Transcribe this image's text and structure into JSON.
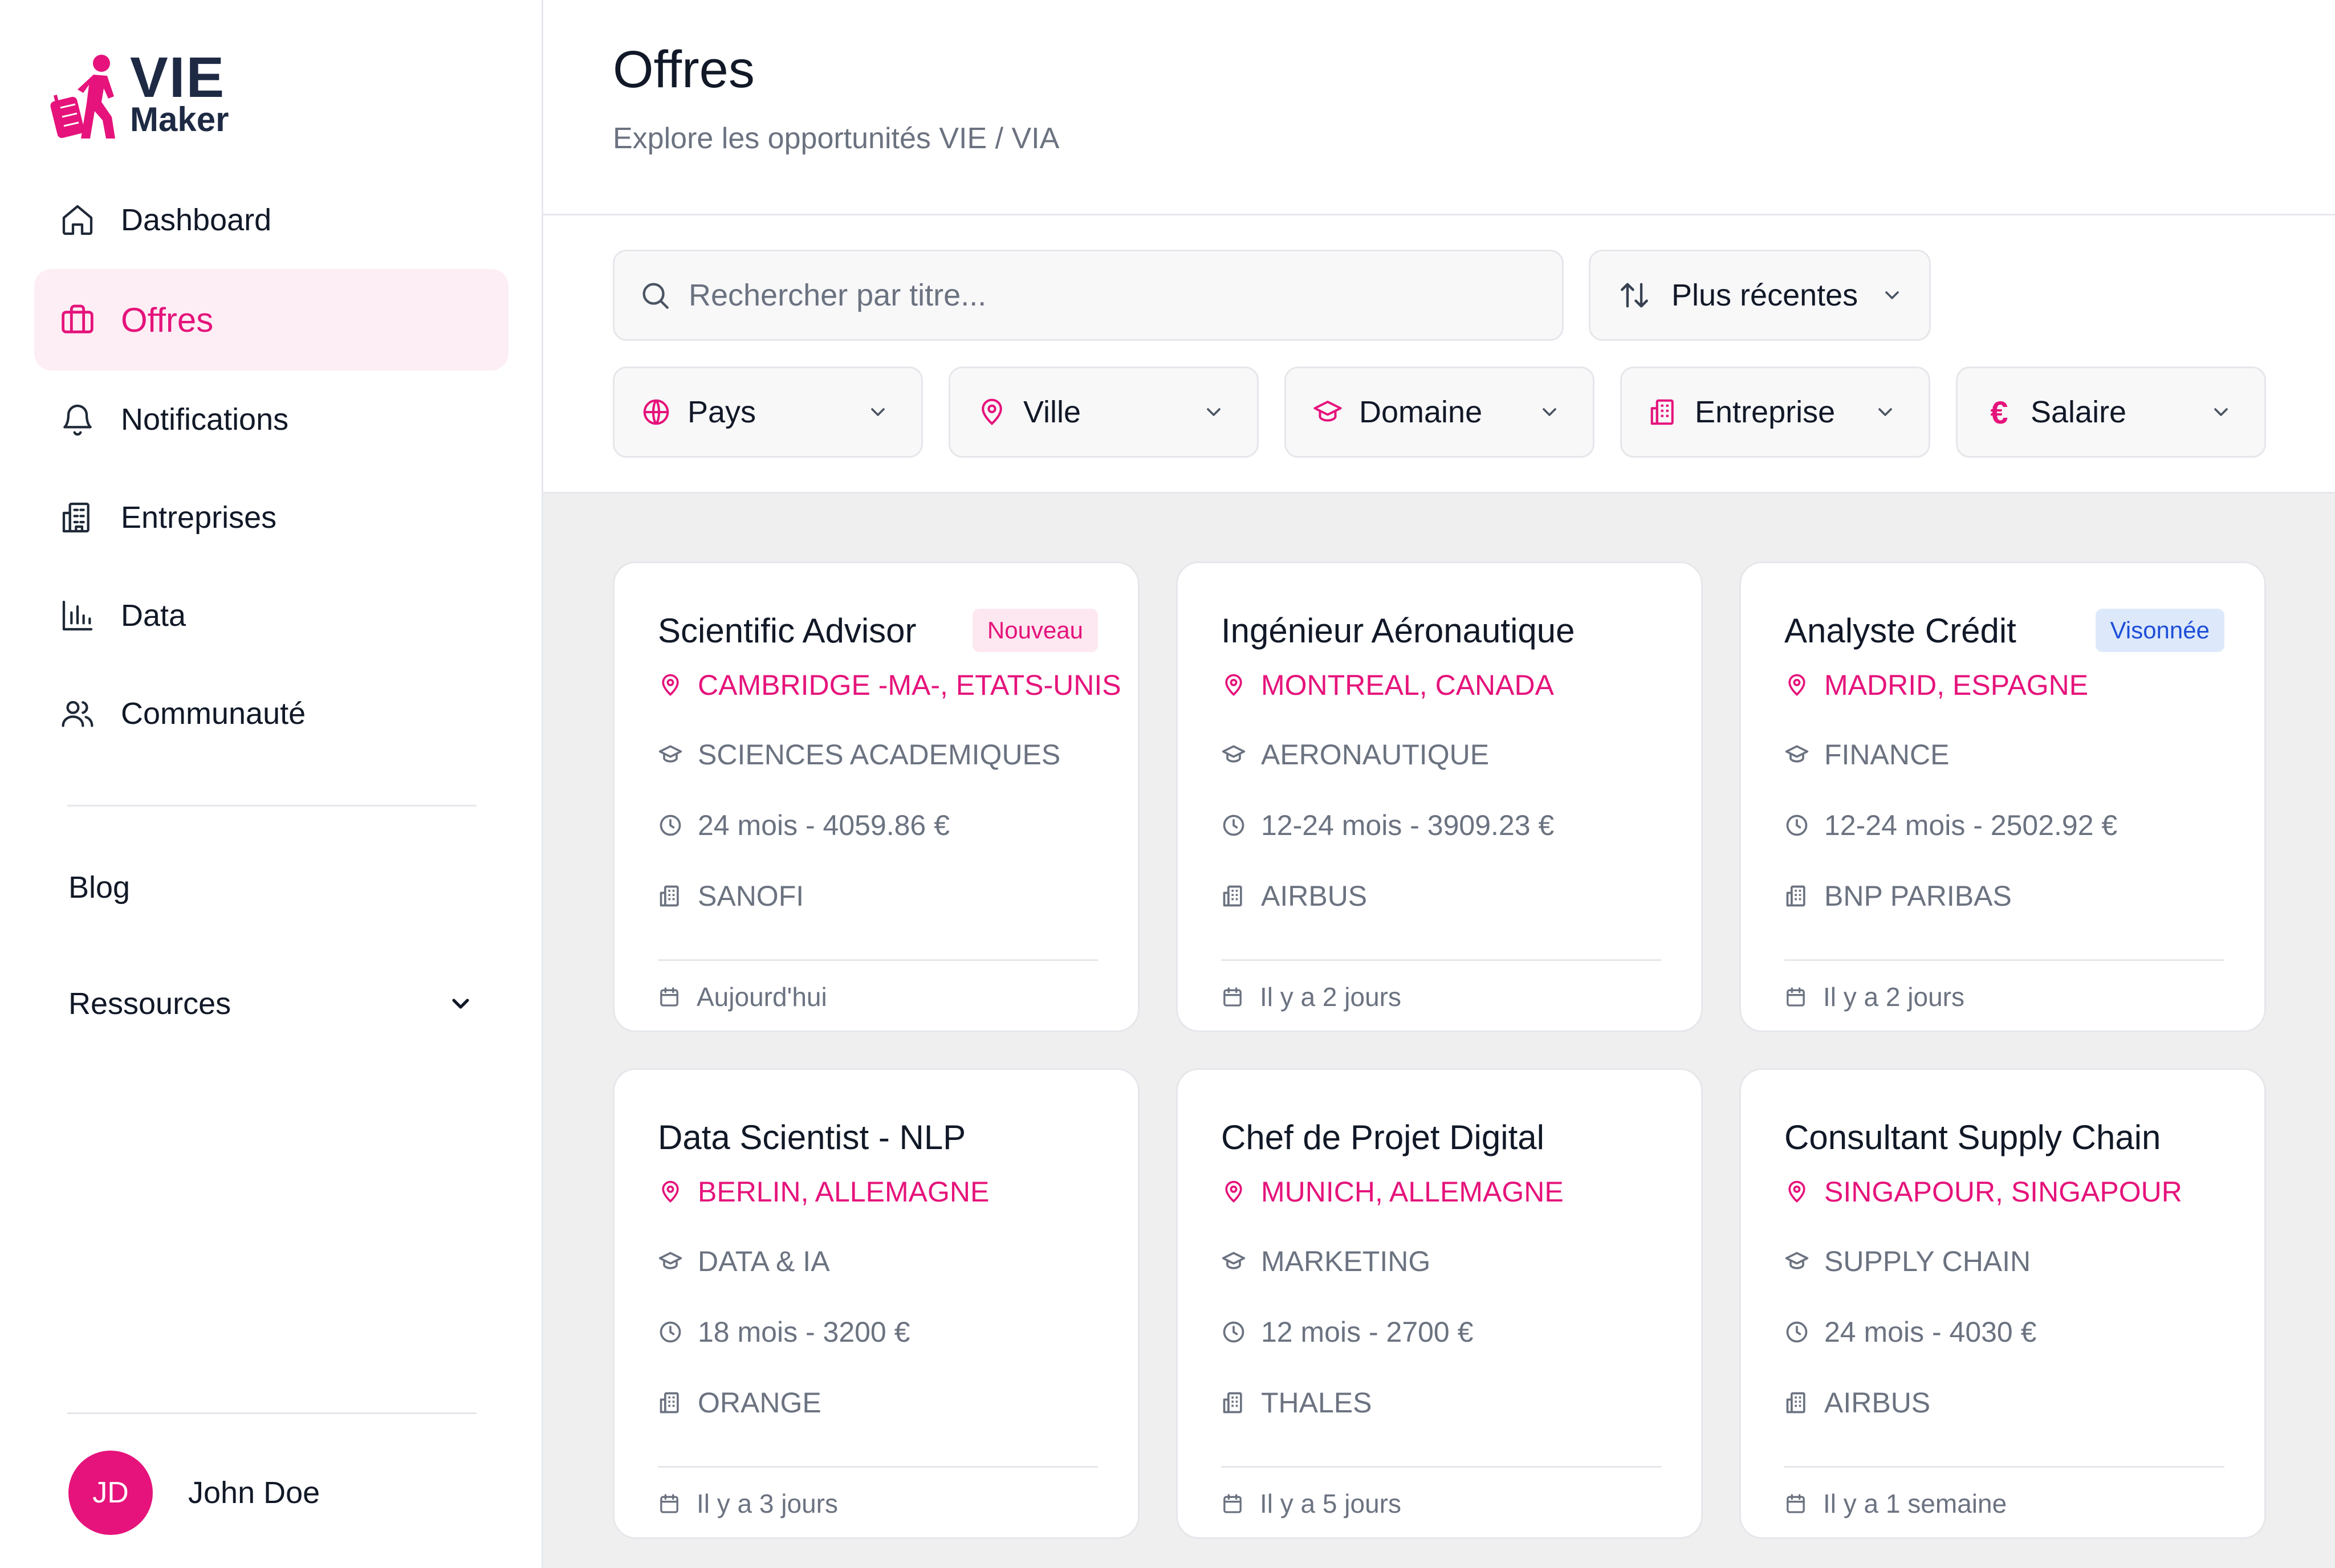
{
  "brand": {
    "line1": "VIE",
    "line2": "Maker",
    "accent": "#e5137b",
    "navy": "#1e2a44"
  },
  "sidebar": {
    "items": [
      {
        "label": "Dashboard",
        "icon": "home-icon",
        "active": false
      },
      {
        "label": "Offres",
        "icon": "briefcase-icon",
        "active": true
      },
      {
        "label": "Notifications",
        "icon": "bell-icon",
        "active": false
      },
      {
        "label": "Entreprises",
        "icon": "building-icon",
        "active": false
      },
      {
        "label": "Data",
        "icon": "bar-chart-icon",
        "active": false
      },
      {
        "label": "Communauté",
        "icon": "users-icon",
        "active": false
      }
    ],
    "blog": "Blog",
    "resources": "Ressources",
    "user": {
      "initials": "JD",
      "name": "John Doe"
    }
  },
  "header": {
    "title": "Offres",
    "subtitle": "Explore les opportunités VIE / VIA"
  },
  "filters": {
    "search_placeholder": "Rechercher par titre...",
    "sort_label": "Plus récentes",
    "chips": [
      {
        "label": "Pays",
        "icon": "globe-icon"
      },
      {
        "label": "Ville",
        "icon": "map-pin-icon"
      },
      {
        "label": "Domaine",
        "icon": "graduation-cap-icon"
      },
      {
        "label": "Entreprise",
        "icon": "building-icon"
      },
      {
        "label": "Salaire",
        "icon": "euro-icon"
      }
    ]
  },
  "offers": [
    {
      "title": "Scientific Advisor",
      "badge": "Nouveau",
      "badge_type": "new",
      "location": "CAMBRIDGE -MA-, ETATS-UNIS",
      "domain": "SCIENCES ACADEMIQUES",
      "duration": "24 mois - 4059.86 €",
      "company": "SANOFI",
      "posted": "Aujourd'hui"
    },
    {
      "title": "Ingénieur Aéronautique",
      "badge": "",
      "badge_type": "",
      "location": "MONTREAL, CANADA",
      "domain": "AERONAUTIQUE",
      "duration": "12-24 mois - 3909.23 €",
      "company": "AIRBUS",
      "posted": "Il y a 2 jours"
    },
    {
      "title": "Analyste Crédit",
      "badge": "Visonnée",
      "badge_type": "seen",
      "location": "MADRID, ESPAGNE",
      "domain": "FINANCE",
      "duration": "12-24 mois - 2502.92 €",
      "company": "BNP PARIBAS",
      "posted": "Il y a 2 jours"
    },
    {
      "title": "Data Scientist - NLP",
      "badge": "",
      "badge_type": "",
      "location": "BERLIN, ALLEMAGNE",
      "domain": "DATA & IA",
      "duration": "18 mois - 3200 €",
      "company": "ORANGE",
      "posted": "Il y a 3 jours"
    },
    {
      "title": "Chef de Projet Digital",
      "badge": "",
      "badge_type": "",
      "location": "MUNICH, ALLEMAGNE",
      "domain": "MARKETING",
      "duration": "12 mois - 2700 €",
      "company": "THALES",
      "posted": "Il y a 5 jours"
    },
    {
      "title": "Consultant Supply Chain",
      "badge": "",
      "badge_type": "",
      "location": "SINGAPOUR, SINGAPOUR",
      "domain": "SUPPLY CHAIN",
      "duration": "24 mois - 4030 €",
      "company": "AIRBUS",
      "posted": "Il y a 1 semaine"
    }
  ]
}
